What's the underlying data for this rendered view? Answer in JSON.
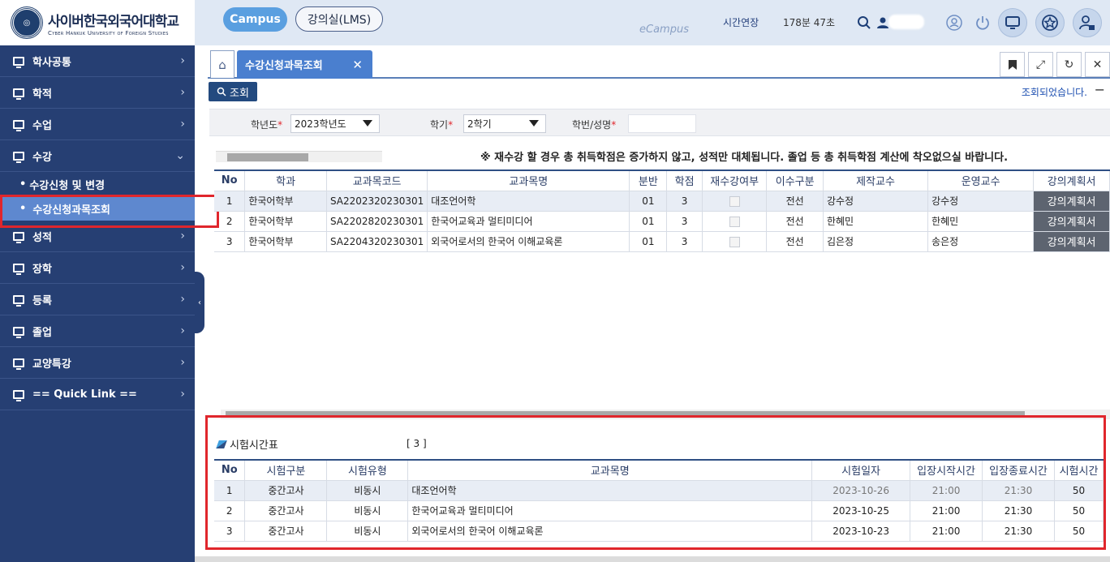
{
  "header": {
    "logo_ko": "사이버한국외국어대학교",
    "logo_en": "Cyber Hankuk University of Foreign Studies",
    "campus_label": "Campus",
    "lms_label": "강의실(LMS)",
    "ecampus_label": "eCampus",
    "time_extend_label": "시간연장",
    "time_remaining": "178분 47초"
  },
  "sidebar": {
    "items": [
      {
        "label": "학사공통"
      },
      {
        "label": "학적"
      },
      {
        "label": "수업"
      },
      {
        "label": "수강"
      },
      {
        "label": "성적"
      },
      {
        "label": "장학"
      },
      {
        "label": "등록"
      },
      {
        "label": "졸업"
      },
      {
        "label": "교양특강"
      },
      {
        "label": "== Quick Link =="
      }
    ],
    "sub_items": [
      {
        "label": "수강신청 및 변경"
      },
      {
        "label": "수강신청과목조회"
      }
    ]
  },
  "tabs": {
    "current": "수강신청과목조회"
  },
  "toolbar": {
    "search_label": "조회",
    "status_message": "조회되었습니다."
  },
  "filters": {
    "year_label": "학년도",
    "year_value": "2023학년도",
    "semester_label": "학기",
    "semester_value": "2학기",
    "student_label": "학번/성명"
  },
  "notice": "※ 재수강 할 경우 총 취득학점은 증가하지 않고, 성적만 대체됩니다. 졸업 등 총 취득학점 계산에 착오없으실 바랍니다.",
  "course_table": {
    "headers": [
      "No",
      "학과",
      "교과목코드",
      "교과목명",
      "분반",
      "학점",
      "재수강여부",
      "이수구분",
      "제작교수",
      "운영교수",
      "강의계획서"
    ],
    "rows": [
      [
        "1",
        "한국어학부",
        "SA2202320230301",
        "대조언어학",
        "01",
        "3",
        "",
        "전선",
        "강수정",
        "강수정",
        "강의계획서"
      ],
      [
        "2",
        "한국어학부",
        "SA2202820230301",
        "한국어교육과 멀티미디어",
        "01",
        "3",
        "",
        "전선",
        "한혜민",
        "한혜민",
        "강의계획서"
      ],
      [
        "3",
        "한국어학부",
        "SA2204320230301",
        "외국어로서의 한국어 이해교육론",
        "01",
        "3",
        "",
        "전선",
        "김은정",
        "송은정",
        "강의계획서"
      ]
    ]
  },
  "exam": {
    "title": "시험시간표",
    "count": "[ 3 ]",
    "headers": [
      "No",
      "시험구분",
      "시험유형",
      "교과목명",
      "시험일자",
      "입장시작시간",
      "입장종료시간",
      "시험시간"
    ],
    "rows": [
      [
        "1",
        "중간고사",
        "비동시",
        "대조언어학",
        "2023-10-26",
        "21:00",
        "21:30",
        "50"
      ],
      [
        "2",
        "중간고사",
        "비동시",
        "한국어교육과 멀티미디어",
        "2023-10-25",
        "21:00",
        "21:30",
        "50"
      ],
      [
        "3",
        "중간고사",
        "비동시",
        "외국어로서의 한국어 이해교육론",
        "2023-10-23",
        "21:00",
        "21:30",
        "50"
      ]
    ]
  },
  "colors": {
    "sidebar_bg": "#263f73",
    "accent": "#4a7fcf",
    "highlight_red": "#e0262c"
  }
}
